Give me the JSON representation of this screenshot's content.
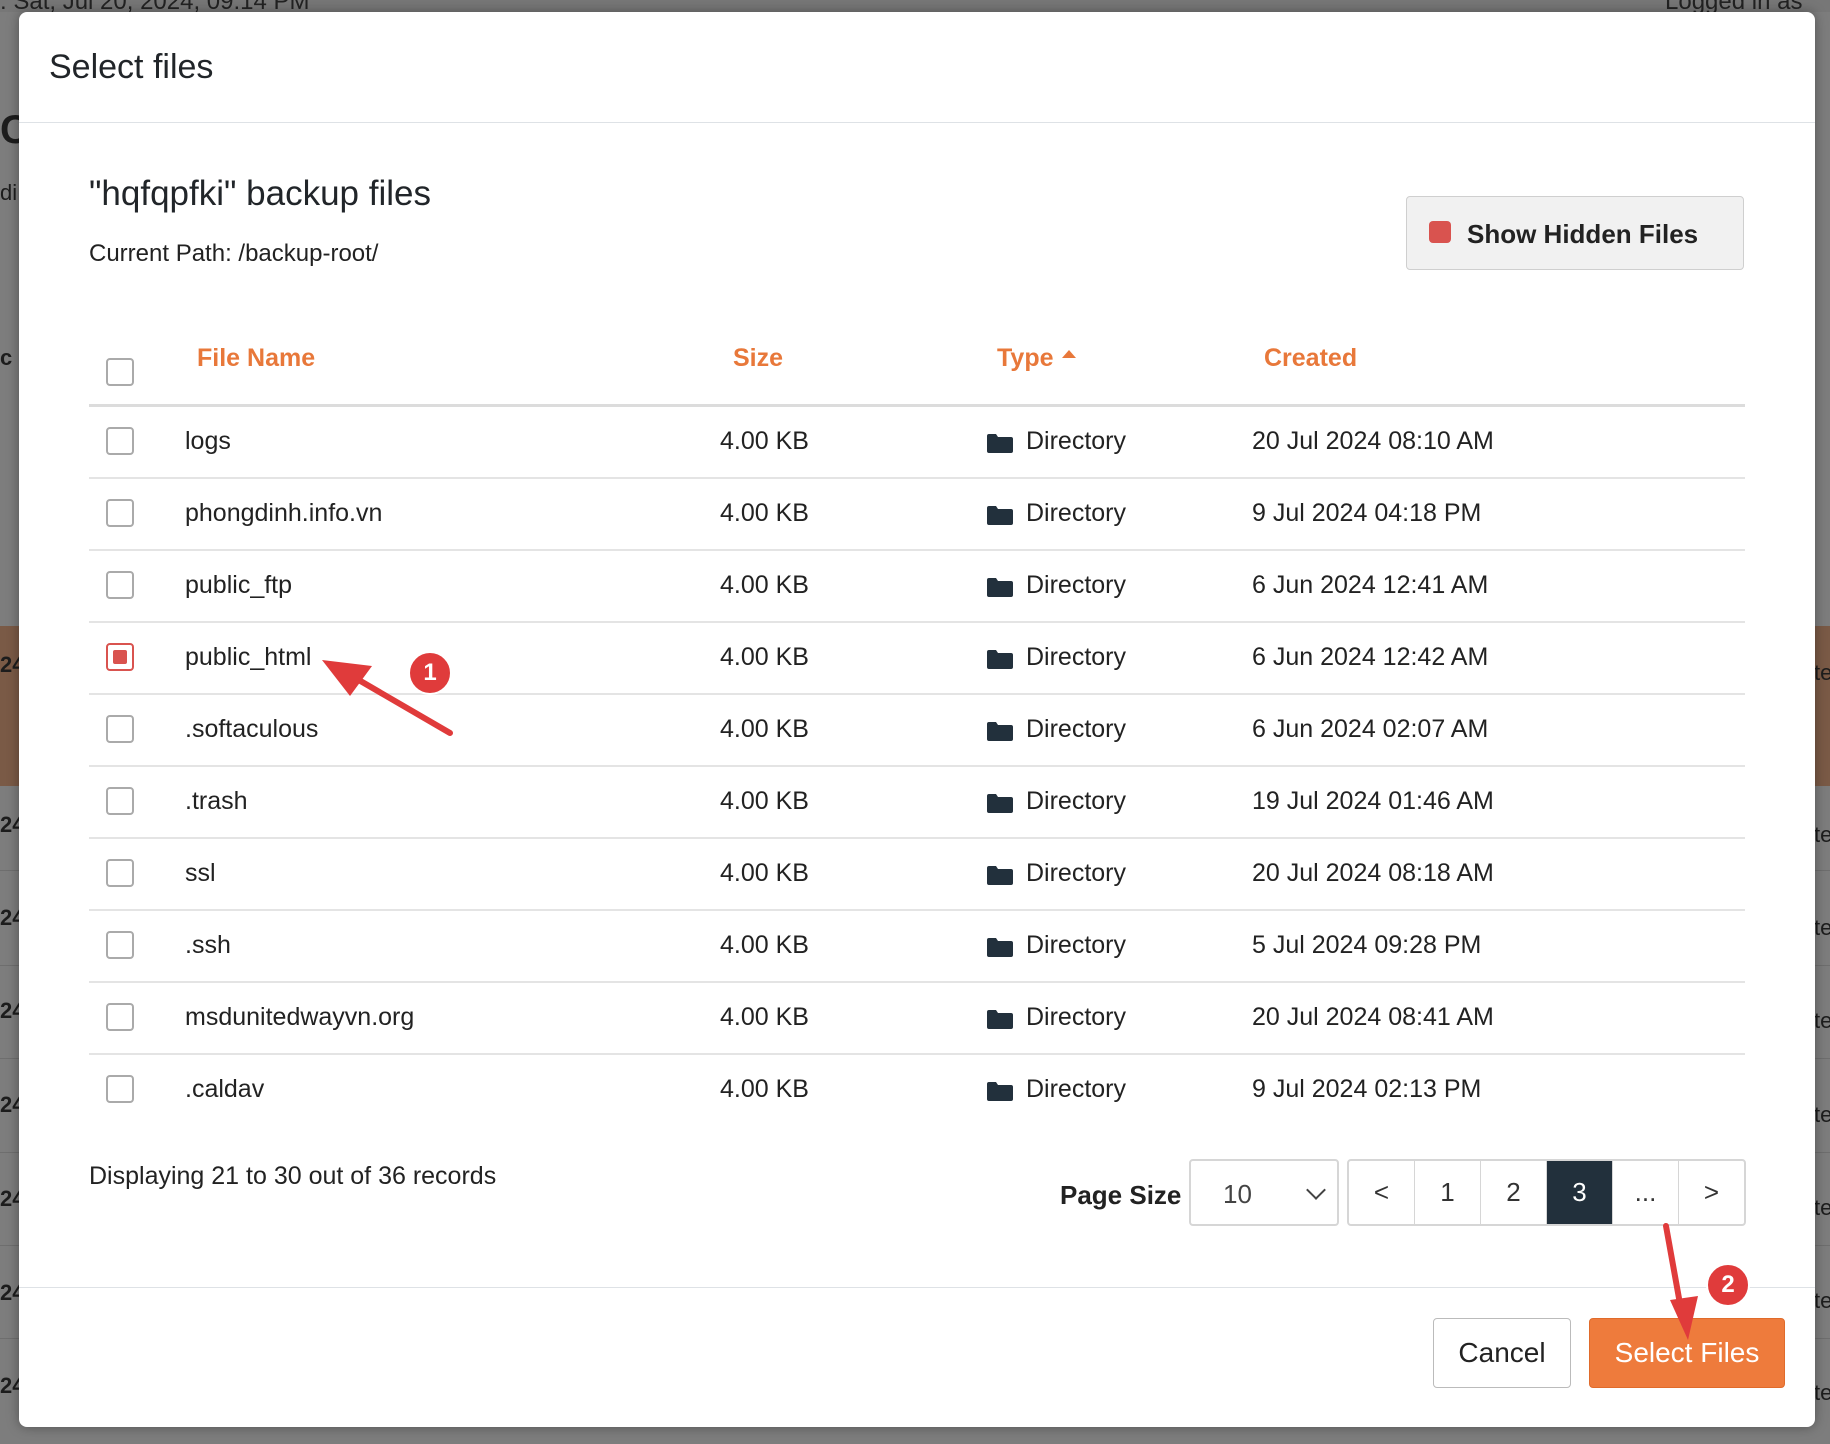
{
  "background": {
    "top_left_text": ": Sat, Jul 20, 2024, 09:14 PM",
    "top_right_text": "Logged in as",
    "edge_left": [
      "C",
      "di",
      "c",
      "24",
      "24",
      "24",
      "24",
      "24",
      "24",
      "24",
      "24"
    ],
    "edge_right": [
      "te",
      "te",
      "te",
      "te",
      "te",
      "te",
      "te",
      "te"
    ]
  },
  "modal": {
    "title": "Select files",
    "heading": "\"hqfqpfki\" backup files",
    "current_path": "Current Path: /backup-root/",
    "show_hidden_label": "Show Hidden Files",
    "show_hidden_checked": true
  },
  "table": {
    "columns": [
      "File Name",
      "Size",
      "Type",
      "Created"
    ],
    "sorted_column": "Type",
    "rows": [
      {
        "name": "logs",
        "size": "4.00 KB",
        "type": "Directory",
        "created": "20 Jul 2024 08:10 AM",
        "checked": false
      },
      {
        "name": "phongdinh.info.vn",
        "size": "4.00 KB",
        "type": "Directory",
        "created": "9 Jul 2024 04:18 PM",
        "checked": false
      },
      {
        "name": "public_ftp",
        "size": "4.00 KB",
        "type": "Directory",
        "created": "6 Jun 2024 12:41 AM",
        "checked": false
      },
      {
        "name": "public_html",
        "size": "4.00 KB",
        "type": "Directory",
        "created": "6 Jun 2024 12:42 AM",
        "checked": true
      },
      {
        "name": ".softaculous",
        "size": "4.00 KB",
        "type": "Directory",
        "created": "6 Jun 2024 02:07 AM",
        "checked": false
      },
      {
        "name": ".trash",
        "size": "4.00 KB",
        "type": "Directory",
        "created": "19 Jul 2024 01:46 AM",
        "checked": false
      },
      {
        "name": "ssl",
        "size": "4.00 KB",
        "type": "Directory",
        "created": "20 Jul 2024 08:18 AM",
        "checked": false
      },
      {
        "name": ".ssh",
        "size": "4.00 KB",
        "type": "Directory",
        "created": "5 Jul 2024 09:28 PM",
        "checked": false
      },
      {
        "name": "msdunitedwayvn.org",
        "size": "4.00 KB",
        "type": "Directory",
        "created": "20 Jul 2024 08:41 AM",
        "checked": false
      },
      {
        "name": ".caldav",
        "size": "4.00 KB",
        "type": "Directory",
        "created": "9 Jul 2024 02:13 PM",
        "checked": false
      }
    ]
  },
  "pagination": {
    "records_text": "Displaying 21 to 30 out of 36 records",
    "page_size_label": "Page Size",
    "page_size_value": "10",
    "pages": [
      "<",
      "1",
      "2",
      "3",
      "...",
      ">"
    ],
    "active_page": "3"
  },
  "footer": {
    "cancel_label": "Cancel",
    "select_label": "Select Files"
  },
  "annotations": {
    "badge_1": "1",
    "badge_2": "2",
    "arrow_color": "#e03b3b"
  },
  "colors": {
    "accent_orange": "#ee7b3c",
    "header_orange": "#e8783a",
    "checked_red": "#d9534f",
    "active_page_bg": "#22303c"
  }
}
